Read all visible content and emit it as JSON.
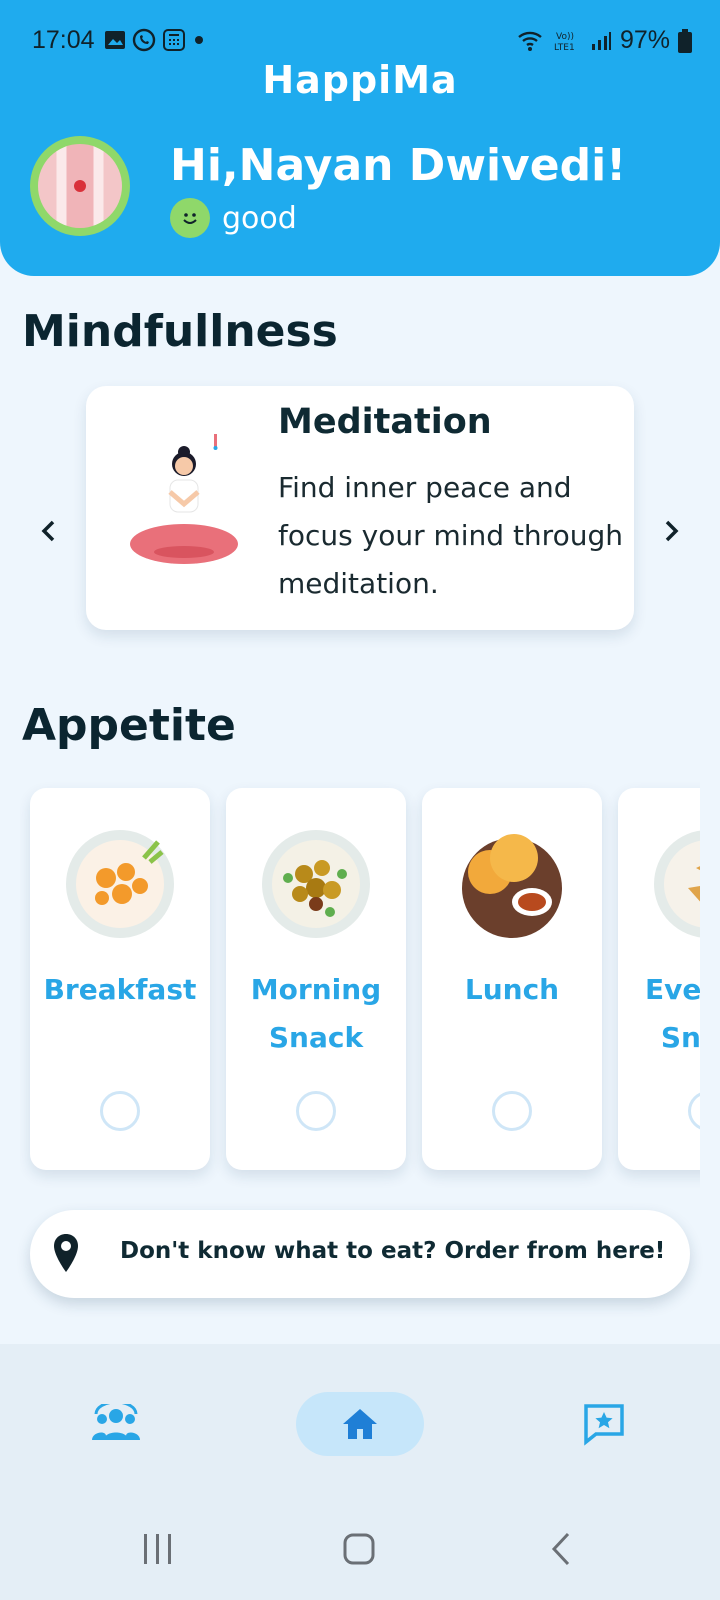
{
  "status": {
    "time": "17:04",
    "battery": "97%"
  },
  "app": {
    "title": "HappiMa"
  },
  "user": {
    "greeting": "Hi,Nayan Dwivedi!",
    "mood": "good"
  },
  "mindfulness": {
    "title": "Mindfullness",
    "card": {
      "title": "Meditation",
      "description": "Find inner peace and focus your mind through meditation."
    }
  },
  "appetite": {
    "title": "Appetite",
    "meals": [
      {
        "label": "Breakfast"
      },
      {
        "label": "Morning Snack"
      },
      {
        "label": "Lunch"
      },
      {
        "label": "Evening Snack"
      }
    ]
  },
  "order": {
    "text": "Don't know what to eat? Order from here!"
  },
  "nav": {
    "items": [
      {
        "icon": "community-icon"
      },
      {
        "icon": "home-icon",
        "active": true
      },
      {
        "icon": "feedback-icon"
      }
    ]
  },
  "colors": {
    "primary": "#1fabee",
    "accent": "#29a6e6",
    "mood": "#8fd86a"
  }
}
